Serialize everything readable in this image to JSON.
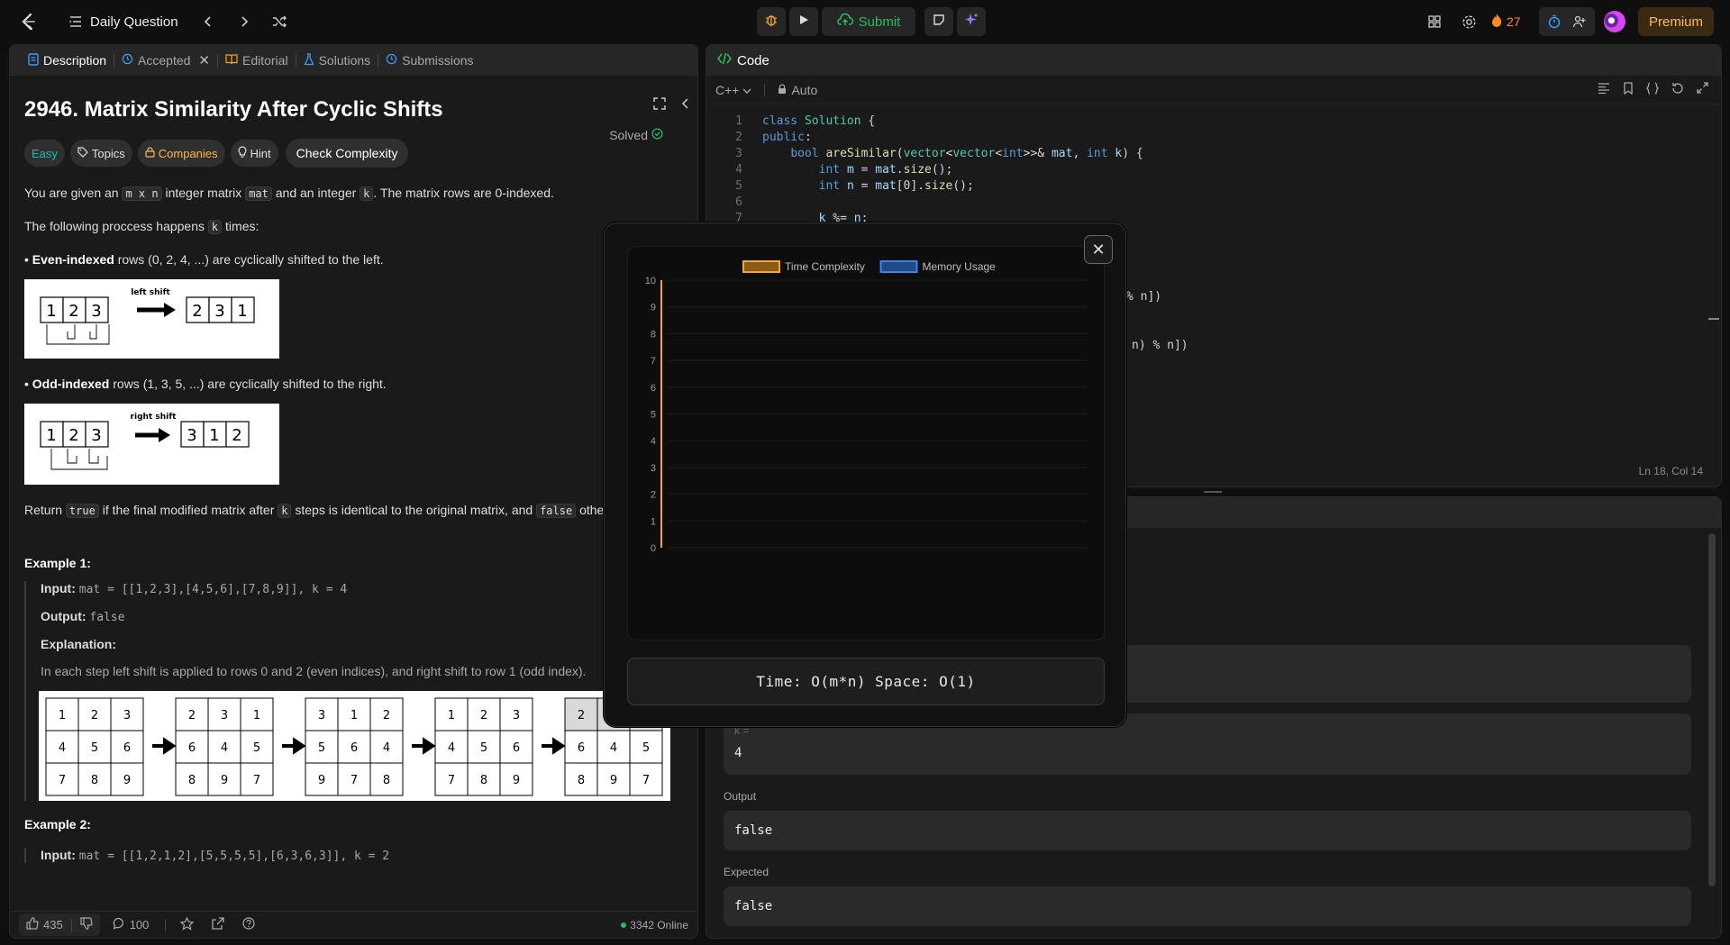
{
  "topbar": {
    "problem_list_label": "Daily Question",
    "submit_label": "Submit",
    "streak_count": "27",
    "premium_label": "Premium"
  },
  "description": {
    "tabs": [
      {
        "label": "Description"
      },
      {
        "label": "Accepted"
      },
      {
        "label": "Editorial"
      },
      {
        "label": "Solutions"
      },
      {
        "label": "Submissions"
      }
    ],
    "title": "2946. Matrix Similarity After Cyclic Shifts",
    "solved_label": "Solved",
    "tags": {
      "difficulty": "Easy",
      "topics": "Topics",
      "companies": "Companies",
      "hint": "Hint",
      "check": "Check Complexity"
    },
    "p1_a": "You are given an ",
    "p1_code1": "m x n",
    "p1_b": " integer matrix ",
    "p1_code2": "mat",
    "p1_c": " and an integer ",
    "p1_code3": "k",
    "p1_d": ". The matrix rows are 0-indexed.",
    "p2_a": "The following proccess happens ",
    "p2_code": "k",
    "p2_b": " times:",
    "bullet1_bold": "Even-indexed",
    "bullet1_rest": " rows (0, 2, 4, ...) are cyclically shifted to the left.",
    "img1_caption": "left shift",
    "bullet2_bold": "Odd-indexed",
    "bullet2_rest": " rows (1, 3, 5, ...) are cyclically shifted to the right.",
    "img2_caption": "right shift",
    "p3_a": "Return ",
    "p3_code1": "true",
    "p3_b": " if the final modified matrix after ",
    "p3_code2": "k",
    "p3_c": " steps is identical to the original matrix, and ",
    "p3_code3": "false",
    "p3_d": " other",
    "example1_title": "Example 1:",
    "ex1_input_label": "Input:",
    "ex1_input": "mat = [[1,2,3],[4,5,6],[7,8,9]], k = 4",
    "ex1_output_label": "Output:",
    "ex1_output": "false",
    "ex1_expl_label": "Explanation:",
    "ex1_expl": "In each step left shift is applied to rows 0 and 2 (even indices), and right shift to row 1 (odd index).",
    "example2_title": "Example 2:",
    "ex2_input_label": "Input:",
    "ex2_input": "mat = [[1,2,1,2],[5,5,5,5],[6,3,6,3]], k = 2",
    "footer": {
      "likes": "435",
      "comments": "100",
      "online": "3342 Online"
    }
  },
  "code": {
    "tab_label": "Code",
    "language": "C++",
    "mode": "Auto",
    "cursor": "Ln 18, Col 14",
    "line_numbers": [
      "1",
      "2",
      "3",
      "4",
      "5",
      "6",
      "7"
    ],
    "tail1": "% n])",
    "tail2": "n) % n])"
  },
  "test": {
    "k_label": "k =",
    "k_value": "4",
    "output_label": "Output",
    "output_value": "false",
    "expected_label": "Expected",
    "expected_value": "false"
  },
  "modal": {
    "result": "Time: O(m*n) Space: O(1)"
  },
  "chart_data": {
    "type": "line",
    "title": "",
    "legend": [
      "Time Complexity",
      "Memory Usage"
    ],
    "legend_position": "top",
    "series": [
      {
        "name": "Time Complexity",
        "color": "#f5a623",
        "values": []
      },
      {
        "name": "Memory Usage",
        "color": "#3b82f6",
        "values": []
      }
    ],
    "ylim": [
      0,
      10
    ],
    "yticks": [
      "0",
      "1",
      "2",
      "3",
      "4",
      "5",
      "6",
      "7",
      "8",
      "9",
      "10"
    ],
    "grid": true
  }
}
